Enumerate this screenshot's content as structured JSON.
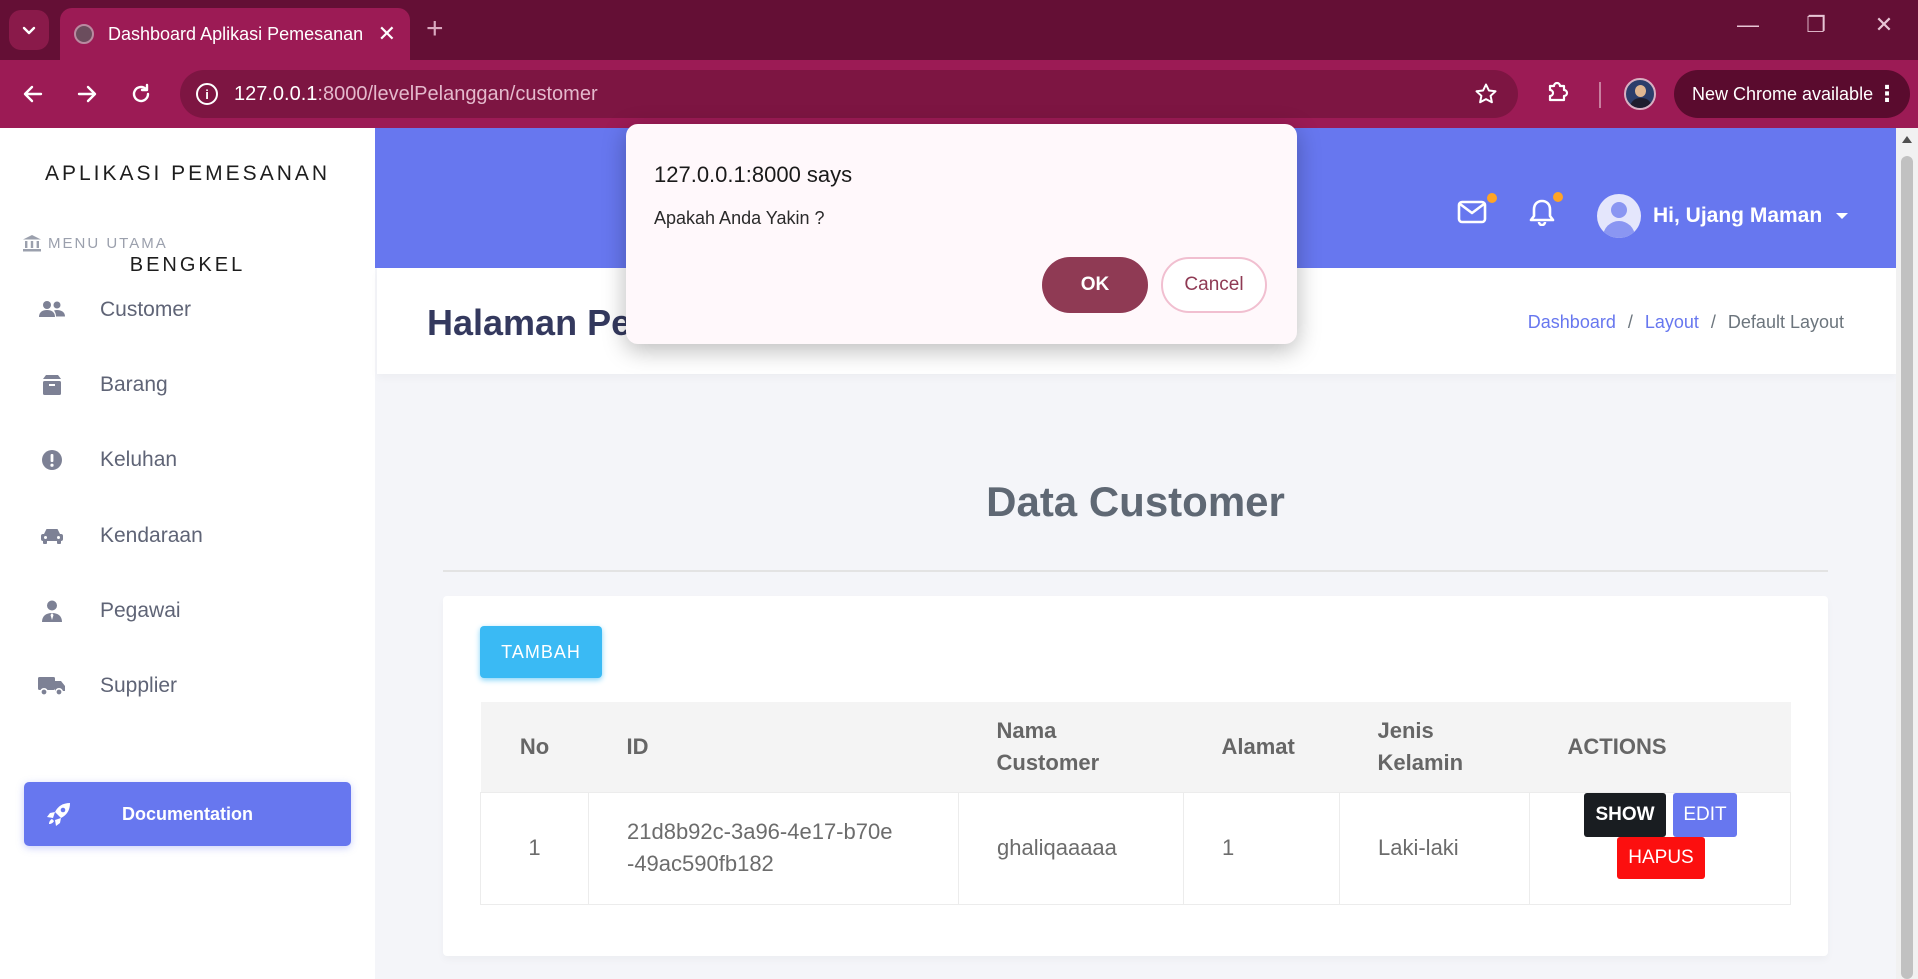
{
  "browser": {
    "tab_title": "Dashboard Aplikasi Pemesanan",
    "new_tab_symbol": "+",
    "close_symbol": "✕",
    "url_host": "127.0.0.1",
    "url_rest": ":8000/levelPelanggan/customer",
    "update_chip": "New Chrome available",
    "window_min": "—",
    "window_restore": "❐",
    "window_close": "✕"
  },
  "sidebar": {
    "brand": "APLIKASI PEMESANAN",
    "menu_heading": "MENU UTAMA",
    "brand_sub": "BENGKEL",
    "items": [
      {
        "label": "Customer",
        "icon": "users-icon"
      },
      {
        "label": "Barang",
        "icon": "box-icon"
      },
      {
        "label": "Keluhan",
        "icon": "exclamation-icon"
      },
      {
        "label": "Kendaraan",
        "icon": "car-icon"
      },
      {
        "label": "Pegawai",
        "icon": "user-tie-icon"
      },
      {
        "label": "Supplier",
        "icon": "truck-icon"
      }
    ],
    "documentation": "Documentation"
  },
  "topnav": {
    "user_name": "Hi, Ujang Maman"
  },
  "section": {
    "title": "Halaman Pe",
    "breadcrumb": [
      "Dashboard",
      "Layout",
      "Default Layout"
    ]
  },
  "main": {
    "heading": "Data Customer",
    "add_button": "TAMBAH",
    "table": {
      "headers": [
        "No",
        "ID",
        "Nama Customer",
        "Alamat",
        "Jenis Kelamin",
        "ACTIONS"
      ],
      "rows": [
        {
          "no": "1",
          "id": "21d8b92c-3a96-4e17-b70e-49ac590fb182",
          "nama": "ghaliqaaaaa",
          "alamat": "1",
          "jenis_kelamin": "Laki-laki"
        }
      ]
    },
    "actions": {
      "show": "SHOW",
      "edit": "EDIT",
      "hapus": "HAPUS"
    }
  },
  "dialog": {
    "origin": "127.0.0.1:8000 says",
    "message": "Apakah Anda Yakin ?",
    "ok": "OK",
    "cancel": "Cancel"
  },
  "colors": {
    "chrome_frame": "#640f35",
    "chrome_toolbar": "#9c1b55",
    "primary": "#6777ef",
    "info": "#3abaf4",
    "danger": "#fc0f0f",
    "dark": "#191d21",
    "dialog_ok": "#8f3a54"
  }
}
